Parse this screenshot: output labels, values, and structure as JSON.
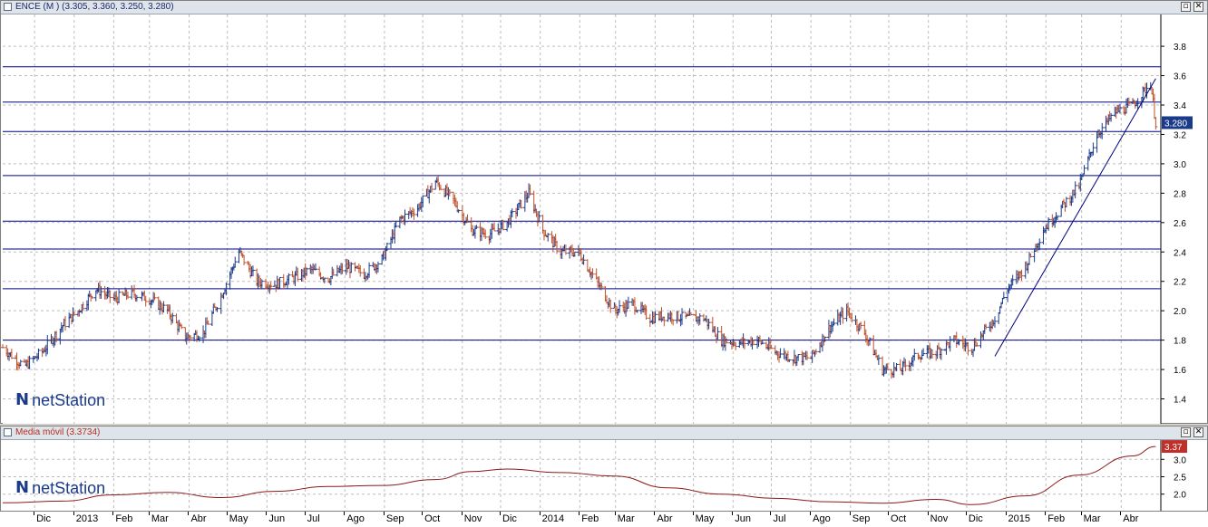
{
  "main_panel": {
    "title": "ENCE (M ) (3.305, 3.360, 3.250, 3.280)",
    "last_price_tag": "3.280",
    "logo_text": "netStation"
  },
  "sub_panel": {
    "title": "Media móvil (3.3734)",
    "last_value_tag": "3.37",
    "logo_text": "netStation"
  },
  "window_buttons": {
    "restore": "▫",
    "close": "✕"
  },
  "colors": {
    "up_bar": "#1a3a8a",
    "down_bar": "#c0502a",
    "line": "#000080",
    "ma": "#8b1a1a",
    "tag_bg": "#1a3a8a",
    "tag_red": "#c0302a"
  },
  "chart_data": [
    {
      "type": "ohlc",
      "title": "ENCE (M ) (3.305, 3.360, 3.250, 3.280)",
      "ylim": [
        1.28,
        3.93
      ],
      "yticks": [
        "3.8",
        "3.6",
        "3.4",
        "3.2",
        "3.0",
        "2.8",
        "2.6",
        "2.4",
        "2.2",
        "2.0",
        "1.8",
        "1.6",
        "1.4"
      ],
      "horizontal_lines": [
        3.66,
        3.42,
        3.22,
        2.92,
        2.61,
        2.42,
        2.15,
        1.8
      ],
      "trendline": {
        "from": {
          "x": "2015-01-02",
          "y": 1.69
        },
        "to": {
          "x": "2015-05-08",
          "y": 3.58
        }
      },
      "grid": true,
      "x_labels": [
        "Dic",
        "2013",
        "Feb",
        "Mar",
        "Abr",
        "May",
        "Jun",
        "Jul",
        "Ago",
        "Sep",
        "Oct",
        "Nov",
        "Dic",
        "2014",
        "Feb",
        "Mar",
        "Abr",
        "May",
        "Jun",
        "Jul",
        "Ago",
        "Sep",
        "Oct",
        "Nov",
        "Dic",
        "2015",
        "Feb",
        "Mar",
        "Abr"
      ],
      "series": [
        {
          "x": [
            "2012-11-16",
            "2012-12-03",
            "2012-12-17",
            "2013-01-02",
            "2013-01-14",
            "2013-01-28",
            "2013-02-11",
            "2013-02-25",
            "2013-03-11",
            "2013-03-25",
            "2013-04-08",
            "2013-04-22",
            "2013-05-06",
            "2013-05-20",
            "2013-06-03",
            "2013-06-17",
            "2013-07-01",
            "2013-07-15",
            "2013-07-29",
            "2013-08-12",
            "2013-08-26",
            "2013-09-09",
            "2013-09-23",
            "2013-10-07",
            "2013-10-21",
            "2013-11-04",
            "2013-11-18",
            "2013-12-02",
            "2013-12-16",
            "2014-01-02",
            "2014-01-13",
            "2014-01-27",
            "2014-02-10",
            "2014-02-24",
            "2014-03-10",
            "2014-03-24",
            "2014-04-07",
            "2014-04-21",
            "2014-05-05",
            "2014-05-19",
            "2014-06-02",
            "2014-06-16",
            "2014-06-30",
            "2014-07-14",
            "2014-07-28",
            "2014-08-11",
            "2014-08-25",
            "2014-09-08",
            "2014-09-22",
            "2014-10-06",
            "2014-10-20",
            "2014-11-03",
            "2014-11-17",
            "2014-12-01",
            "2014-12-15",
            "2015-01-02",
            "2015-01-12",
            "2015-01-26",
            "2015-02-09",
            "2015-02-23",
            "2015-03-09",
            "2015-03-23",
            "2015-04-06",
            "2015-04-20",
            "2015-05-04",
            "2015-05-08"
          ],
          "values": [
            1.75,
            1.62,
            1.72,
            1.9,
            2.0,
            2.15,
            2.08,
            2.12,
            2.08,
            2.0,
            1.82,
            1.85,
            2.1,
            2.4,
            2.2,
            2.18,
            2.22,
            2.28,
            2.22,
            2.3,
            2.25,
            2.35,
            2.62,
            2.7,
            2.88,
            2.75,
            2.55,
            2.52,
            2.6,
            2.8,
            2.55,
            2.4,
            2.4,
            2.2,
            2.0,
            2.05,
            1.95,
            1.97,
            1.95,
            1.95,
            1.8,
            1.78,
            1.8,
            1.72,
            1.68,
            1.68,
            1.88,
            2.0,
            1.85,
            1.6,
            1.6,
            1.7,
            1.72,
            1.8,
            1.75,
            1.95,
            2.15,
            2.3,
            2.55,
            2.7,
            2.85,
            3.2,
            3.35,
            3.4,
            3.55,
            3.28
          ]
        }
      ]
    },
    {
      "type": "line",
      "title": "Media móvil (3.3734)",
      "ylim": [
        1.68,
        3.45
      ],
      "yticks": [
        "3.0",
        "2.5",
        "2.0"
      ],
      "series": [
        {
          "x": [
            "2012-11-16",
            "2013-01-02",
            "2013-02-11",
            "2013-03-25",
            "2013-05-06",
            "2013-06-17",
            "2013-07-29",
            "2013-09-09",
            "2013-10-21",
            "2013-11-18",
            "2013-12-16",
            "2014-01-27",
            "2014-03-10",
            "2014-04-21",
            "2014-06-02",
            "2014-07-14",
            "2014-08-25",
            "2014-10-06",
            "2014-11-17",
            "2014-12-15",
            "2015-01-26",
            "2015-03-09",
            "2015-04-20",
            "2015-05-08"
          ],
          "values": [
            1.75,
            1.8,
            1.98,
            2.05,
            1.9,
            2.08,
            2.22,
            2.25,
            2.42,
            2.65,
            2.72,
            2.62,
            2.52,
            2.18,
            2.0,
            1.88,
            1.78,
            1.74,
            1.85,
            1.7,
            1.95,
            2.55,
            3.1,
            3.37
          ]
        }
      ]
    }
  ]
}
